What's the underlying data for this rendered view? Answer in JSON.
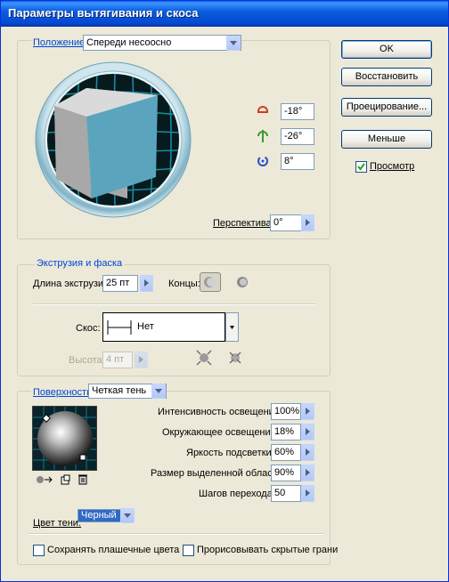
{
  "window": {
    "title": "Параметры вытягивания и скоса"
  },
  "position": {
    "label": "Положение:",
    "preset": "Спереди несоосно",
    "rotation_x": "-18°",
    "rotation_y": "-26°",
    "rotation_z": "8°",
    "perspective_label": "Перспектива:",
    "perspective_value": "0°"
  },
  "buttons": {
    "ok": "OK",
    "reset": "Восстановить",
    "map": "Проецирование...",
    "less": "Меньше",
    "preview": "Просмотр"
  },
  "extrude": {
    "legend": "Экструзия и фаска",
    "depth_label": "Длина экструзии:",
    "depth_value": "25 пт",
    "caps_label": "Концы:",
    "bevel_label": "Скос:",
    "bevel_value": "Нет",
    "height_label": "Высота:",
    "height_value": "4 пт"
  },
  "surface": {
    "label": "Поверхность:",
    "type": "Четкая тень",
    "light_intensity_label": "Интенсивность освещения:",
    "light_intensity": "100%",
    "ambient_label": "Окружающее освещение:",
    "ambient": "18%",
    "highlight_intensity_label": "Яркость подсветки:",
    "highlight_intensity": "60%",
    "highlight_size_label": "Размер выделенной области:",
    "highlight_size": "90%",
    "blend_steps_label": "Шагов перехода:",
    "blend_steps": "50",
    "shading_color_label": "Цвет тени:",
    "shading_color": "Черный",
    "preserve_spot_label": "Сохранять плашечные цвета",
    "draw_hidden_label": "Прорисовывать скрытые грани"
  },
  "colors": {
    "accent": "#0046D5",
    "cube_front": "#5AA5BD",
    "cube_top": "#DADADA",
    "cube_side": "#A8A8A8"
  }
}
